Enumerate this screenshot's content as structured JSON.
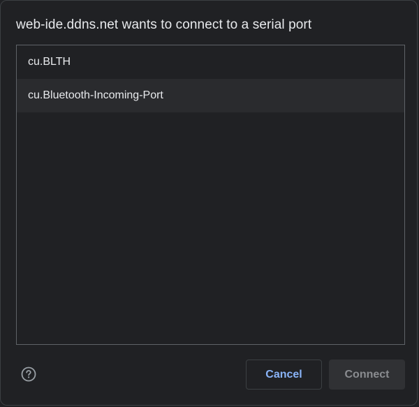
{
  "dialog": {
    "title": "web-ide.ddns.net wants to connect to a serial port"
  },
  "ports": [
    {
      "label": "cu.BLTH"
    },
    {
      "label": "cu.Bluetooth-Incoming-Port"
    }
  ],
  "footer": {
    "help_icon": "help-circle-icon",
    "cancel_label": "Cancel",
    "connect_label": "Connect"
  },
  "colors": {
    "background": "#202124",
    "text": "#e8eaed",
    "accent": "#8ab4f8",
    "disabled_text": "#8a8c90",
    "hover_row": "#2a2b2e"
  }
}
